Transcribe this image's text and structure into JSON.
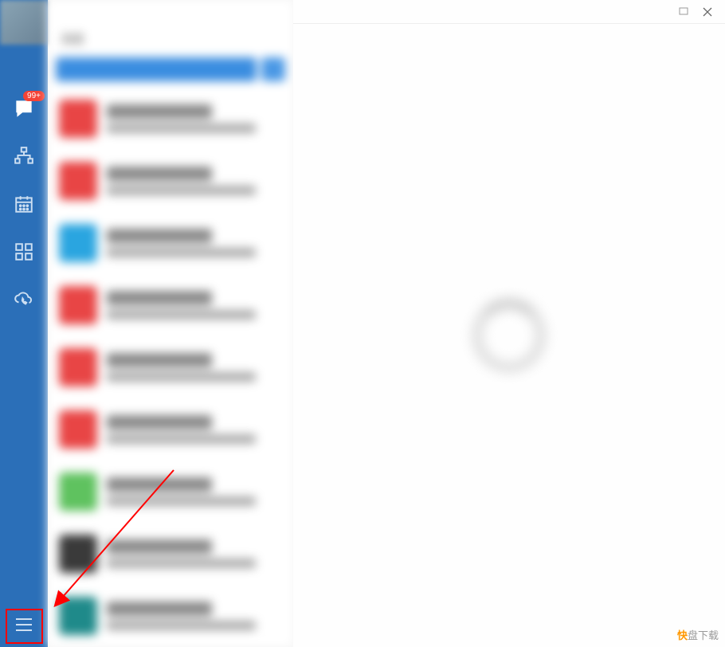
{
  "sidebar": {
    "chat_badge": "99+",
    "icons": [
      "chat",
      "contacts",
      "calendar",
      "apps",
      "cloud-call"
    ]
  },
  "list": {
    "title_placeholder": "消息",
    "items": [
      {
        "avatar_color": "#e84545"
      },
      {
        "avatar_color": "#e84545"
      },
      {
        "avatar_color": "#2aa5e0"
      },
      {
        "avatar_color": "#e84545"
      },
      {
        "avatar_color": "#e84545"
      },
      {
        "avatar_color": "#e84545"
      },
      {
        "avatar_color": "#5fc25f"
      },
      {
        "avatar_color": "#3a3a3a"
      },
      {
        "avatar_color": "#1f8a8a"
      }
    ]
  },
  "content": {
    "loading_visible": true
  },
  "watermark": {
    "brand": "快",
    "suffix": "盘下载"
  },
  "annotation": {
    "arrow_target": "menu-button"
  }
}
